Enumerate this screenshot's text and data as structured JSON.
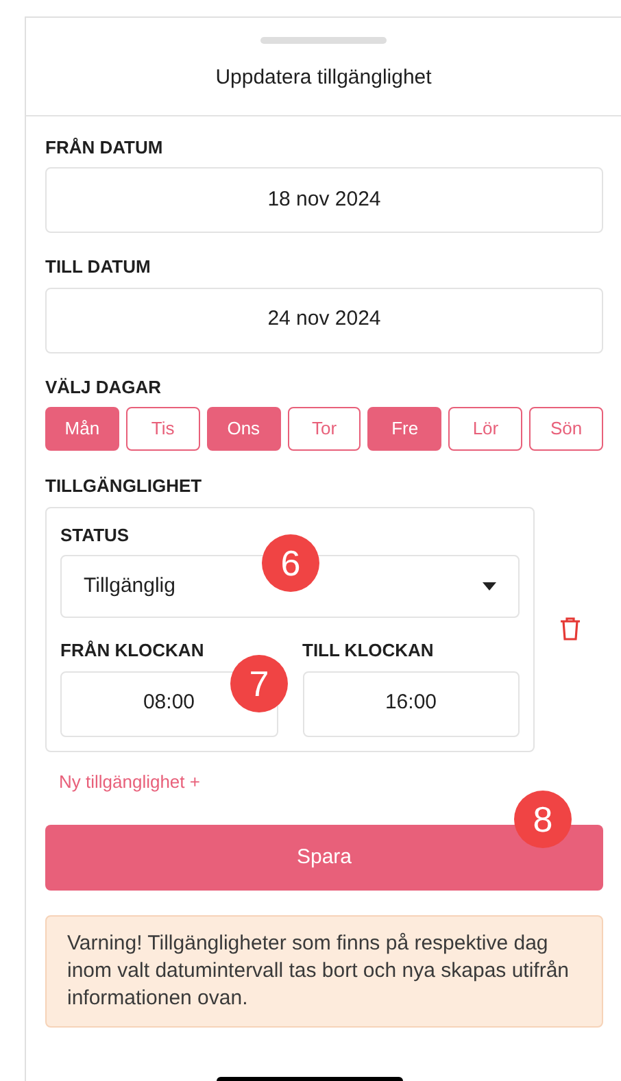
{
  "sheet": {
    "title": "Uppdatera tillgänglighet"
  },
  "from_date": {
    "label": "FRÅN DATUM",
    "value": "18 nov 2024"
  },
  "to_date": {
    "label": "TILL DATUM",
    "value": "24 nov 2024"
  },
  "days": {
    "label": "VÄLJ DAGAR",
    "items": [
      {
        "label": "Mån",
        "selected": true
      },
      {
        "label": "Tis",
        "selected": false
      },
      {
        "label": "Ons",
        "selected": true
      },
      {
        "label": "Tor",
        "selected": false
      },
      {
        "label": "Fre",
        "selected": true
      },
      {
        "label": "Lör",
        "selected": false
      },
      {
        "label": "Sön",
        "selected": false
      }
    ]
  },
  "availability": {
    "label": "TILLGÄNGLIGHET",
    "status_label": "STATUS",
    "status_value": "Tillgänglig",
    "from_label": "FRÅN KLOCKAN",
    "from_value": "08:00",
    "to_label": "TILL KLOCKAN",
    "to_value": "16:00"
  },
  "add_link": "Ny tillgänglighet +",
  "save_button": "Spara",
  "warning": "Varning! Tillgängligheter som finns på respektive dag inom valt datumintervall tas bort och nya skapas utifrån informationen ovan.",
  "markers": [
    "6",
    "7",
    "8"
  ]
}
